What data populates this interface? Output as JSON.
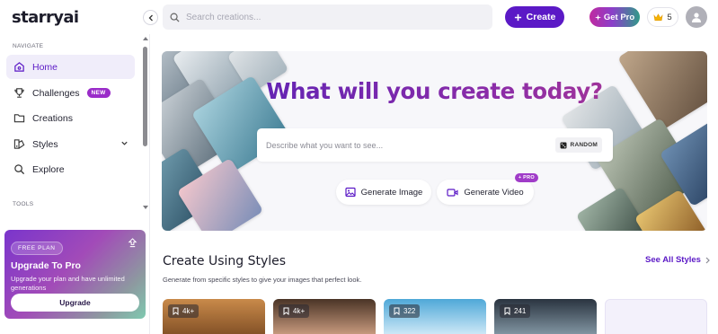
{
  "app": {
    "logo_text": "starryai"
  },
  "search": {
    "placeholder": "Search creations..."
  },
  "header": {
    "create_label": "Create",
    "get_pro_label": "Get Pro",
    "credits": "5"
  },
  "sidebar": {
    "navigate_label": "NAVIGATE",
    "tools_label": "TOOLS",
    "items": [
      {
        "label": "Home",
        "icon": "home-icon",
        "active": true
      },
      {
        "label": "Challenges",
        "icon": "trophy-icon",
        "badge": "NEW"
      },
      {
        "label": "Creations",
        "icon": "folder-icon"
      },
      {
        "label": "Styles",
        "icon": "styles-icon",
        "has_chevron": true
      },
      {
        "label": "Explore",
        "icon": "search-icon"
      }
    ],
    "upgrade": {
      "plan": "FREE PLAN",
      "title": "Upgrade To Pro",
      "description": "Upgrade your plan and have unlimited generations",
      "button": "Upgrade"
    }
  },
  "hero": {
    "title": "What will you create today?",
    "prompt_placeholder": "Describe what you want to see...",
    "random_label": "RANDOM",
    "generate_image_label": "Generate Image",
    "generate_video_label": "Generate Video",
    "pro_badge": "+ PRO"
  },
  "styles_section": {
    "title": "Create Using Styles",
    "subtitle": "Generate from specific styles to give your images that perfect look.",
    "see_all_label": "See All Styles",
    "cards": [
      {
        "count": "4k+"
      },
      {
        "count": "4k+"
      },
      {
        "count": "322"
      },
      {
        "count": "241"
      }
    ]
  },
  "colors": {
    "accent": "#5b19c6",
    "badge_purple": "#9a2cc9"
  }
}
